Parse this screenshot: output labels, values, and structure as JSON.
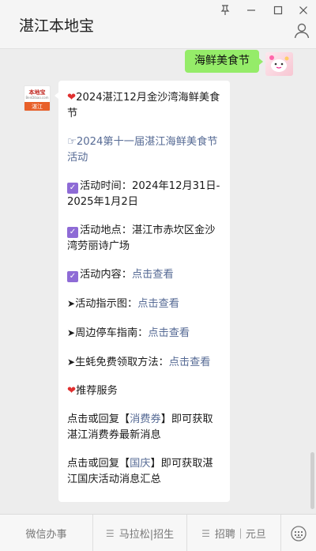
{
  "window": {
    "title": "湛江本地宝",
    "pin_icon": "pin-icon",
    "minimize_icon": "minimize-icon",
    "maximize_icon": "maximize-icon",
    "close_icon": "close-icon",
    "profile_icon": "person-icon"
  },
  "chat": {
    "user_message": "海鲜美食节",
    "bot_avatar": {
      "brand": "本地宝",
      "site": "BenDibao.com",
      "city": "湛江"
    },
    "reply": {
      "title": "2024湛江12月金沙湾海鲜美食节",
      "link_prefix": "☞",
      "link_text": "2024第十一届湛江海鲜美食节活动",
      "time_label": "活动时间：",
      "time_value": "2024年12月31日-2025年1月2日",
      "place_label": "活动地点：",
      "place_value": "湛江市赤坎区金沙湾劳丽诗广场",
      "content_label": "活动内容：",
      "map_label": "活动指示图：",
      "parking_label": "周边停车指南：",
      "oyster_label": "生蚝免费领取方法：",
      "view_link": "点击查看",
      "service_title": "推荐服务",
      "coupon_pre": "点击或回复【",
      "coupon_kw": "消费券",
      "coupon_post": "】即可获取湛江消费券最新消息",
      "holiday_pre": "点击或回复【",
      "holiday_kw": "国庆",
      "holiday_post": "】即可获取湛江国庆活动消息汇总"
    }
  },
  "bottom_menu": {
    "item1": "微信办事",
    "item2": "马拉松|招生",
    "item3": "招聘｜元旦"
  },
  "colors": {
    "bubble_me": "#95ec69",
    "link": "#576b95",
    "heart": "#e02f2f",
    "check": "#8e6bd6"
  }
}
